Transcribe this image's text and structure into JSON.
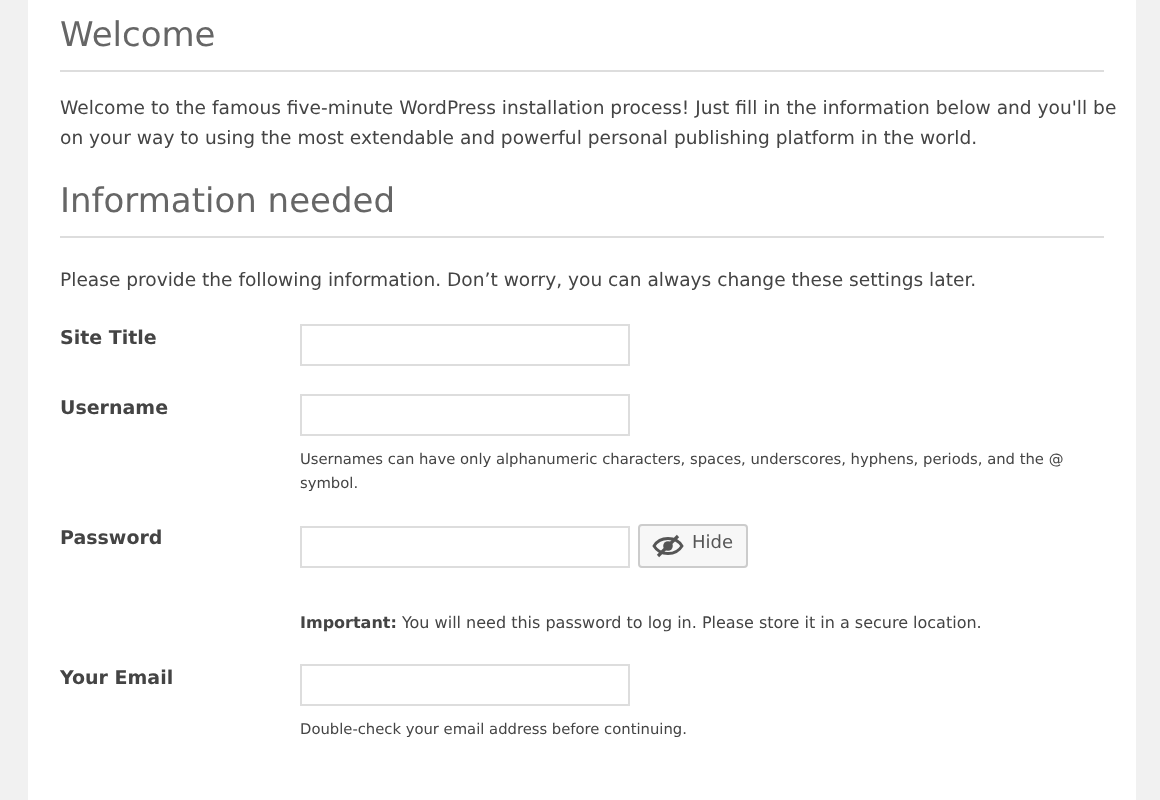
{
  "welcome": {
    "heading": "Welcome",
    "text": "Welcome to the famous five-minute WordPress installation process! Just fill in the information below and you'll be on your way to using the most extendable and powerful personal publishing platform in the world."
  },
  "info": {
    "heading": "Information needed",
    "text": "Please provide the following information. Don’t worry, you can always change these settings later."
  },
  "fields": [
    {
      "label": "Site Title"
    },
    {
      "label": "Username",
      "hint": "Usernames can have only alphanumeric characters, spaces, underscores, hyphens, periods, and the @ symbol."
    },
    {
      "label": "Password",
      "button": "Hide",
      "note": "**Important:** You will need this password to log in. Please store it in a secure location."
    },
    {
      "label": "Your Email",
      "hint": "Double-check your email address before continuing."
    }
  ]
}
